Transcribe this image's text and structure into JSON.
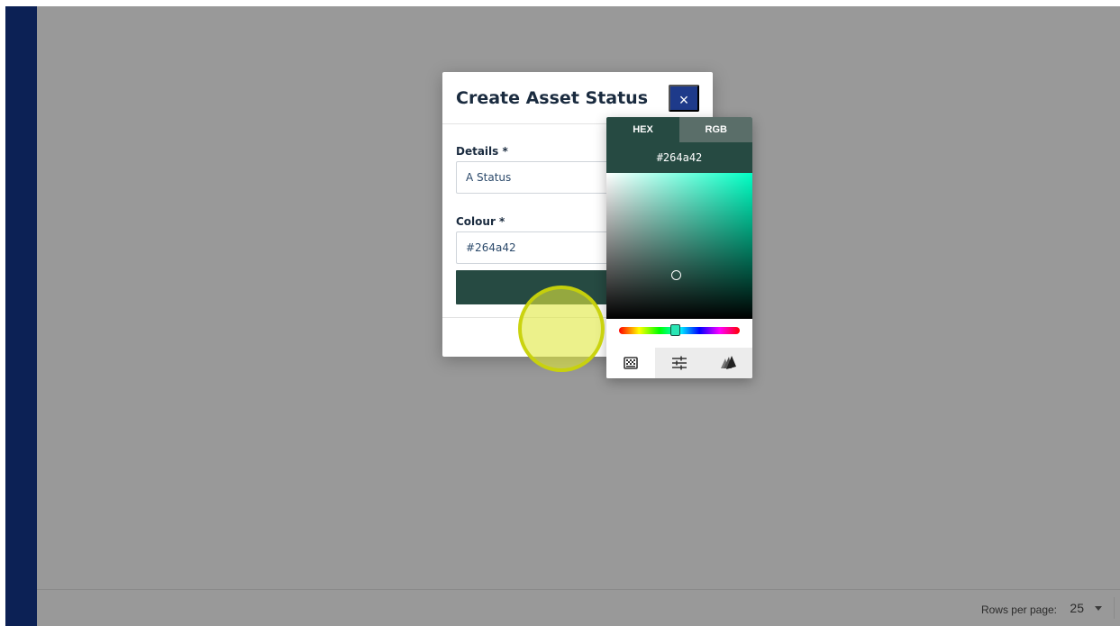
{
  "dialog": {
    "title": "Create Asset Status",
    "close_label": "×",
    "details_label": "Details *",
    "details_value": "A Status",
    "colour_label": "Colour *",
    "colour_value": "#264a42"
  },
  "color_picker": {
    "tabs": [
      {
        "label": "HEX",
        "active": true
      },
      {
        "label": "RGB",
        "active": false
      }
    ],
    "hex_value": "#264a42",
    "selected_color": "#264a42",
    "hue_color": "#00ffc4",
    "modes": [
      "grid-icon",
      "sliders-icon",
      "palette-icon"
    ]
  },
  "footer": {
    "rows_per_page_label": "Rows per page:",
    "rows_per_page_value": "25"
  },
  "colors": {
    "sidebar": "#0c2155",
    "close_button": "#1e3a8a",
    "picker_header": "#264a42"
  }
}
